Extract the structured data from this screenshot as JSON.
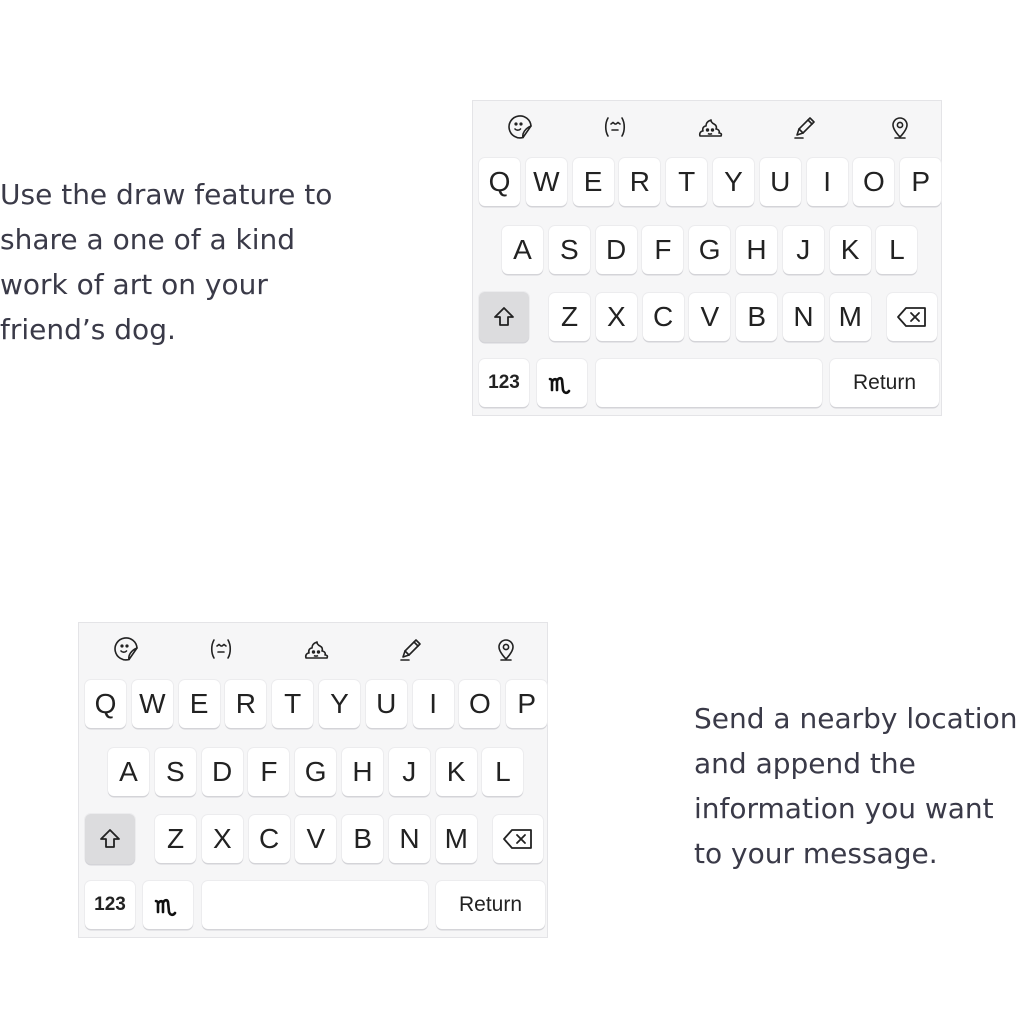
{
  "captions": {
    "top_lines": [
      "Use the draw feature to",
      "share a one of a kind",
      "work of art on your",
      "friend’s dog."
    ],
    "bottom_lines": [
      "Send a nearby location",
      "and append the",
      "information you want",
      "to your message."
    ]
  },
  "keyboard": {
    "toolbar_icons": [
      "sticker-icon",
      "emoji-icon",
      "poop-icon",
      "pencil-icon",
      "location-pin-icon"
    ],
    "row1": [
      "Q",
      "W",
      "E",
      "R",
      "T",
      "Y",
      "U",
      "I",
      "O",
      "P"
    ],
    "row2": [
      "A",
      "S",
      "D",
      "F",
      "G",
      "H",
      "J",
      "K",
      "L"
    ],
    "row3": [
      "Z",
      "X",
      "C",
      "V",
      "B",
      "N",
      "M"
    ],
    "shift_icon": "shift-arrow-icon",
    "backspace_icon": "backspace-icon",
    "numbers_label": "123",
    "draw_key_icon": "handwriting-m-icon",
    "space_label": "",
    "return_label": "Return",
    "colors": {
      "background": "#f6f6f7",
      "key": "#ffffff",
      "shift_active": "#dcdcde",
      "text": "#222222"
    }
  }
}
